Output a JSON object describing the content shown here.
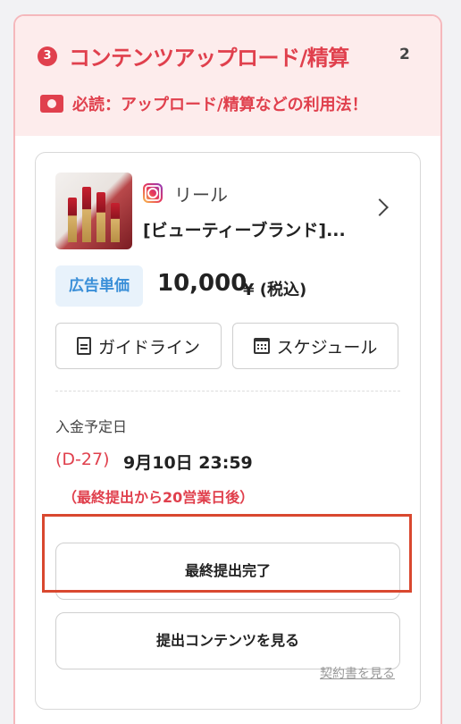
{
  "header": {
    "step_number": "3",
    "title": "コンテンツアップロード/精算",
    "count": "2",
    "notice": "必読：アップロード/精算などの利用法！"
  },
  "card": {
    "content_type": "リール",
    "title": "[ビューティーブランド]...",
    "price_label": "広告単価",
    "price_value": "10,000",
    "price_unit": "¥ (税込)",
    "guideline_button": "ガイドライン",
    "schedule_button": "スケジュール",
    "payment_label": "入金予定日",
    "d_count": "(D-27)",
    "payment_date": "9月10日 23:59",
    "payment_note": "（最終提出から20営業日後）",
    "final_submit_button": "最終提出完了",
    "view_content_button": "提出コンテンツを見る",
    "contract_link": "契約書を見る"
  },
  "colors": {
    "accent": "#e0404d",
    "header_bg": "#fdecec",
    "price_blue": "#3a8fd8",
    "highlight": "#d9482f"
  },
  "icons": [
    "camera-icon",
    "instagram-icon",
    "chevron-right-icon",
    "document-icon",
    "calendar-icon"
  ]
}
